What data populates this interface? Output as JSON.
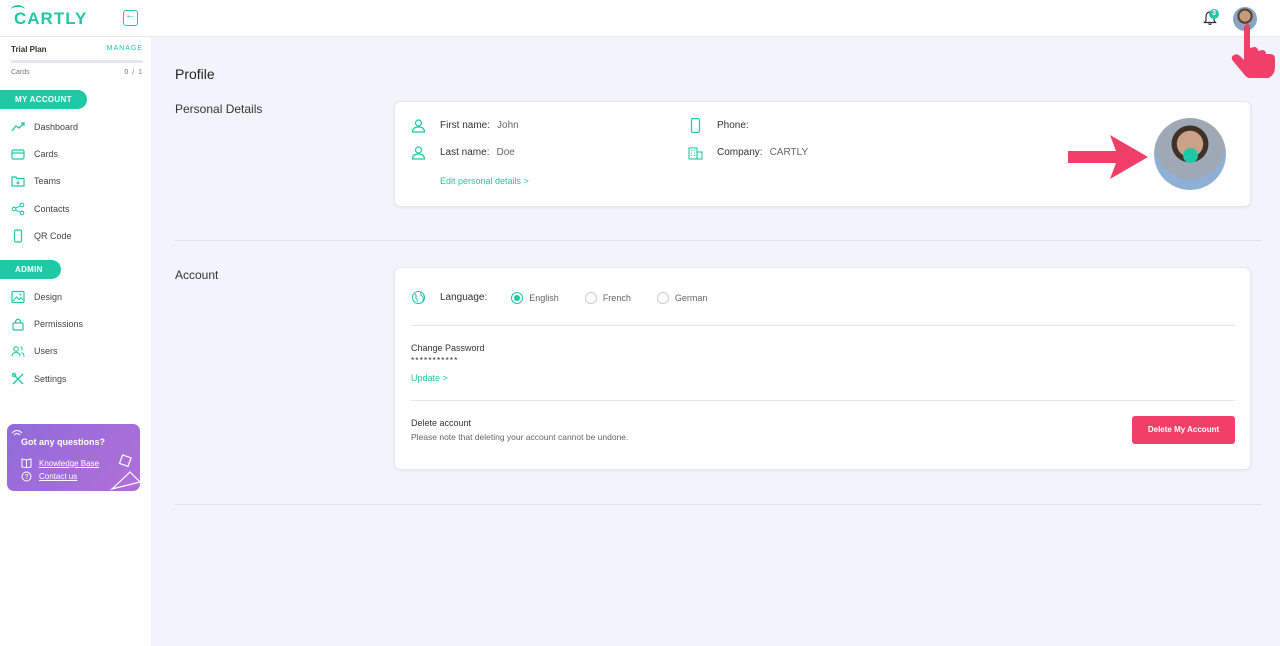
{
  "app": {
    "logo_text": "CARTLY",
    "accent_color": "#1ec9a5",
    "danger_color": "#f0406a"
  },
  "topbar": {
    "notification_count": "3"
  },
  "plan": {
    "name": "Trial Plan",
    "manage_label": "MANAGE",
    "cards_label": "Cards",
    "cards_count": "0 / 1",
    "usage_fraction": 0
  },
  "sidebar": {
    "my_account_label": "MY ACCOUNT",
    "admin_label": "ADMIN",
    "my_account_items": [
      {
        "label": "Dashboard",
        "icon": "trend-icon"
      },
      {
        "label": "Cards",
        "icon": "card-icon"
      },
      {
        "label": "Teams",
        "icon": "folder-icon"
      },
      {
        "label": "Contacts",
        "icon": "share-icon"
      },
      {
        "label": "QR Code",
        "icon": "phone-icon"
      }
    ],
    "admin_items": [
      {
        "label": "Design",
        "icon": "image-icon"
      },
      {
        "label": "Permissions",
        "icon": "lock-icon"
      },
      {
        "label": "Users",
        "icon": "users-icon"
      },
      {
        "label": "Settings",
        "icon": "tools-icon"
      }
    ],
    "help": {
      "title": "Got any questions?",
      "knowledge_base": "Knowledge Base",
      "contact_us": "Contact us"
    }
  },
  "profile": {
    "title": "Profile",
    "personal_section": "Personal Details",
    "first_name_label": "First name:",
    "first_name": "John",
    "last_name_label": "Last name:",
    "last_name": "Doe",
    "phone_label": "Phone:",
    "phone": "",
    "company_label": "Company:",
    "company": "CARTLY",
    "edit_link": "Edit personal details >"
  },
  "account": {
    "section": "Account",
    "language_label": "Language:",
    "languages": [
      "English",
      "French",
      "German"
    ],
    "selected_language": "English",
    "change_password_title": "Change Password",
    "password_mask": "***********",
    "update_link": "Update >",
    "delete_title": "Delete account",
    "delete_note": "Please note that deleting your account cannot be undone.",
    "delete_button": "Delete My Account"
  }
}
